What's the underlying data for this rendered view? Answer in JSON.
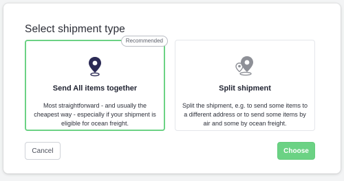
{
  "dialog": {
    "title": "Select shipment type"
  },
  "options": [
    {
      "title": "Send All items together",
      "description": "Most straightforward - and usually the cheapest way - especially if your shipment is eligible for ocean freight.",
      "badge": "Recommended",
      "icon": "map-pin-icon",
      "selected": true
    },
    {
      "title": "Split shipment",
      "description": "Split the shipment, e.g. to send some items to a different address or to send some items by air and some by ocean freight.",
      "icon": "multi-pin-icon",
      "selected": false
    }
  ],
  "buttons": {
    "cancel": "Cancel",
    "choose": "Choose"
  },
  "colors": {
    "accent": "#6bd284",
    "pin_dark": "#2b2a55",
    "pin_gray": "#8e9097"
  }
}
